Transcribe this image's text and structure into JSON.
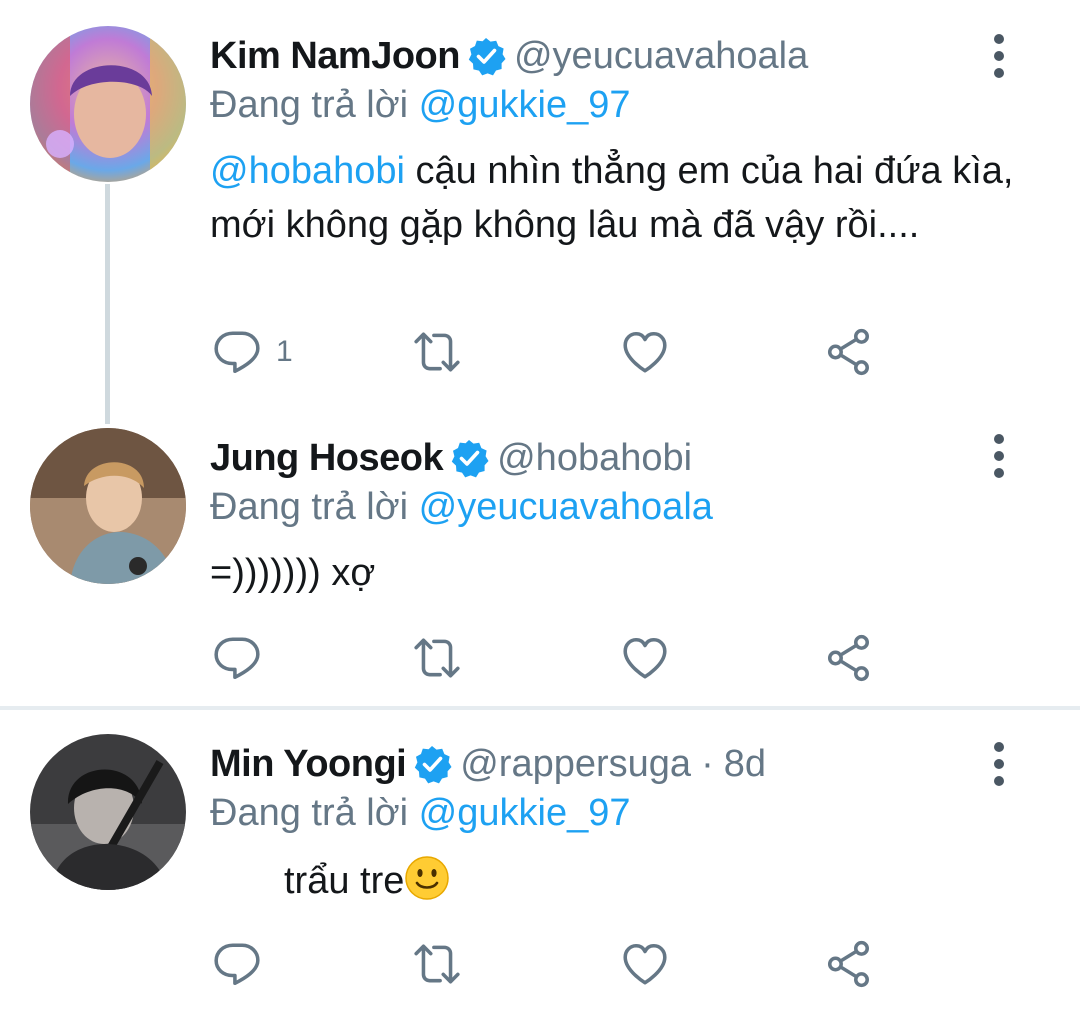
{
  "colors": {
    "accent": "#1da1f2",
    "secondary_text": "#657786",
    "primary_text": "#14171a",
    "divider": "#e6ecf0"
  },
  "tweets": [
    {
      "name": "Kim NamJoon",
      "handle": "@yeucuavahoala",
      "time": "",
      "reply_prefix": "Đang trả lời",
      "reply_mention": "@gukkie_97",
      "body_mention": "@hobahobi",
      "body_text": " cậu nhìn thẳng em của hai đứa kìa, mới không gặp không lâu mà đã vậy rồi....",
      "reply_count": "1",
      "icons": [
        "reply-icon",
        "retweet-icon",
        "like-icon",
        "share-icon"
      ]
    },
    {
      "name": "Jung Hoseok",
      "handle": "@hobahobi",
      "time": "",
      "reply_prefix": "Đang trả lời",
      "reply_mention": "@yeucuavahoala",
      "body_mention": "",
      "body_text": "=))))))) xợ",
      "reply_count": "",
      "icons": [
        "reply-icon",
        "retweet-icon",
        "like-icon",
        "share-icon"
      ]
    },
    {
      "name": "Min Yoongi",
      "handle": "@rappersuga",
      "separator": "·",
      "time": "8d",
      "reply_prefix": "Đang trả lời",
      "reply_mention": "@gukkie_97",
      "body_mention": "",
      "body_text": "trẩu tre",
      "body_emoji": "slightly-smiling-face",
      "reply_count": "",
      "icons": [
        "reply-icon",
        "retweet-icon",
        "like-icon",
        "share-icon"
      ]
    }
  ]
}
